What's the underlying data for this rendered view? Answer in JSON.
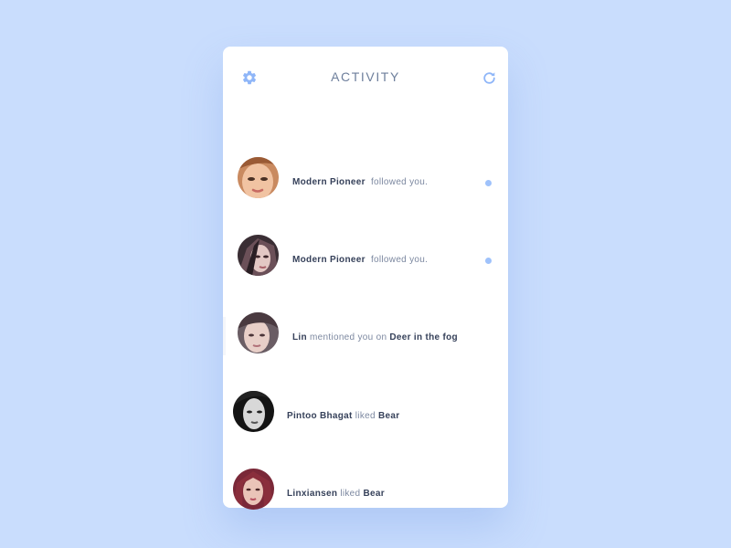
{
  "header": {
    "title": "ACTIVITY",
    "settings_icon": "gear-icon",
    "refresh_icon": "refresh-icon",
    "accent_color": "#8fb6f8"
  },
  "activity": [
    {
      "user": "Modern Pioneer",
      "action": "followed you.",
      "target": "",
      "unread": true
    },
    {
      "user": "Modern Pioneer",
      "action": "followed you.",
      "target": "",
      "unread": true
    },
    {
      "user": "Lin",
      "action": "mentioned you on",
      "target": "Deer in the fog",
      "unread": false
    },
    {
      "user": "Pintoo Bhagat",
      "action": "liked",
      "target": "Bear",
      "unread": false
    },
    {
      "user": "Linxiansen",
      "action": "liked",
      "target": "Bear",
      "unread": false
    }
  ],
  "colors": {
    "background": "#c9ddfd",
    "card": "#ffffff",
    "unread_dot": "#9fc2fb",
    "name_text": "#36415a",
    "action_text": "#7c88a0"
  }
}
